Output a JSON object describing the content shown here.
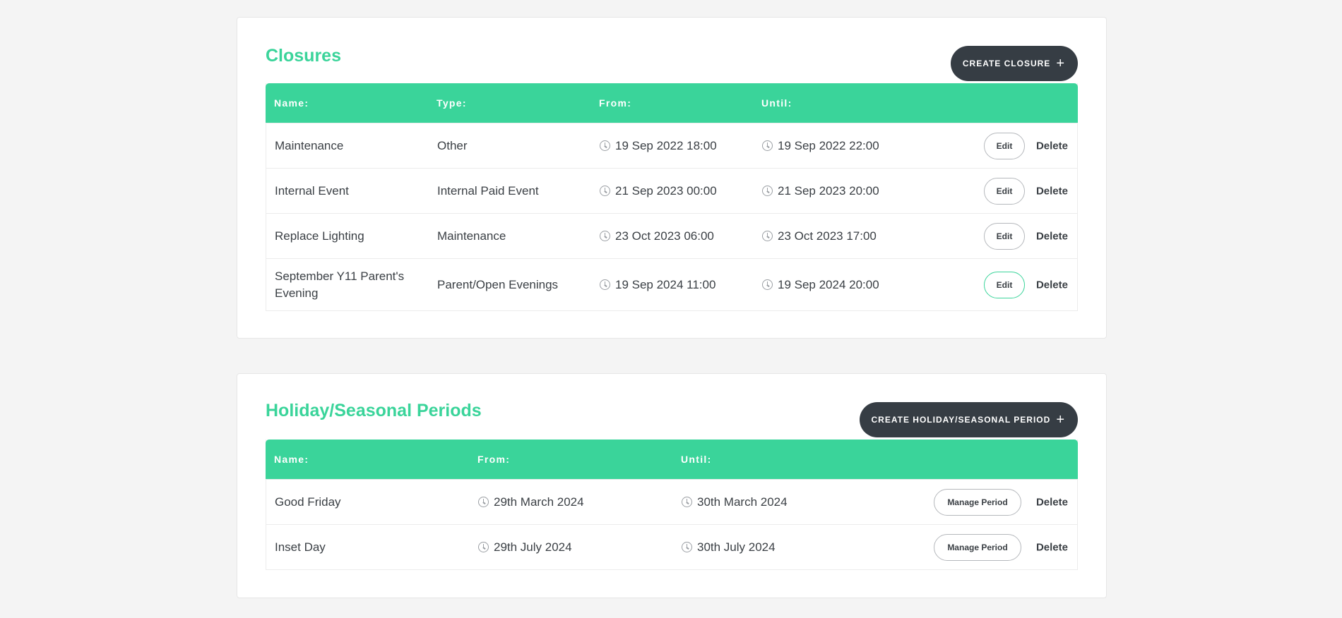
{
  "closures": {
    "title": "Closures",
    "create_label": "CREATE CLOSURE",
    "headers": [
      "Name:",
      "Type:",
      "From:",
      "Until:"
    ],
    "rows": [
      {
        "name": "Maintenance",
        "type": "Other",
        "from": "19 Sep 2022 18:00",
        "until": "19 Sep 2022 22:00",
        "edit": "Edit",
        "delete": "Delete"
      },
      {
        "name": "Internal Event",
        "type": "Internal Paid Event",
        "from": "21 Sep 2023 00:00",
        "until": "21 Sep 2023 20:00",
        "edit": "Edit",
        "delete": "Delete"
      },
      {
        "name": "Replace Lighting",
        "type": "Maintenance",
        "from": "23 Oct 2023 06:00",
        "until": "23 Oct 2023 17:00",
        "edit": "Edit",
        "delete": "Delete"
      },
      {
        "name": "September Y11 Parent's Evening",
        "type": "Parent/Open Evenings",
        "from": "19 Sep 2024 11:00",
        "until": "19 Sep 2024 20:00",
        "edit": "Edit",
        "delete": "Delete"
      }
    ]
  },
  "periods": {
    "title": "Holiday/Seasonal Periods",
    "create_label": "CREATE HOLIDAY/SEASONAL PERIOD",
    "headers": [
      "Name:",
      "From:",
      "Until:"
    ],
    "rows": [
      {
        "name": "Good Friday",
        "from": "29th March 2024",
        "until": "30th March 2024",
        "manage": "Manage Period",
        "delete": "Delete"
      },
      {
        "name": "Inset Day",
        "from": "29th July 2024",
        "until": "30th July 2024",
        "manage": "Manage Period",
        "delete": "Delete"
      }
    ]
  },
  "icons": {
    "plus": "plus-icon",
    "clock": "clock-icon"
  },
  "colors": {
    "accent": "#3ad49a",
    "dark_button": "#363d44",
    "background": "#f4f4f4"
  }
}
